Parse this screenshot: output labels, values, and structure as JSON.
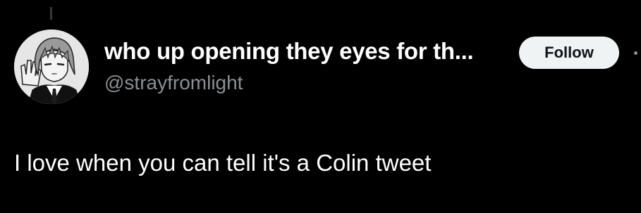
{
  "tweet": {
    "display_name": "who up opening they eyes for th...",
    "handle": "@strayfromlight",
    "follow_label": "Follow",
    "text": "I love when you can tell it's a Colin tweet",
    "avatar_icon": "anime-character-avatar"
  },
  "colors": {
    "background": "#000000",
    "text_primary": "#ffffff",
    "text_secondary": "#8b8f94",
    "follow_button_bg": "#eff3f4"
  }
}
